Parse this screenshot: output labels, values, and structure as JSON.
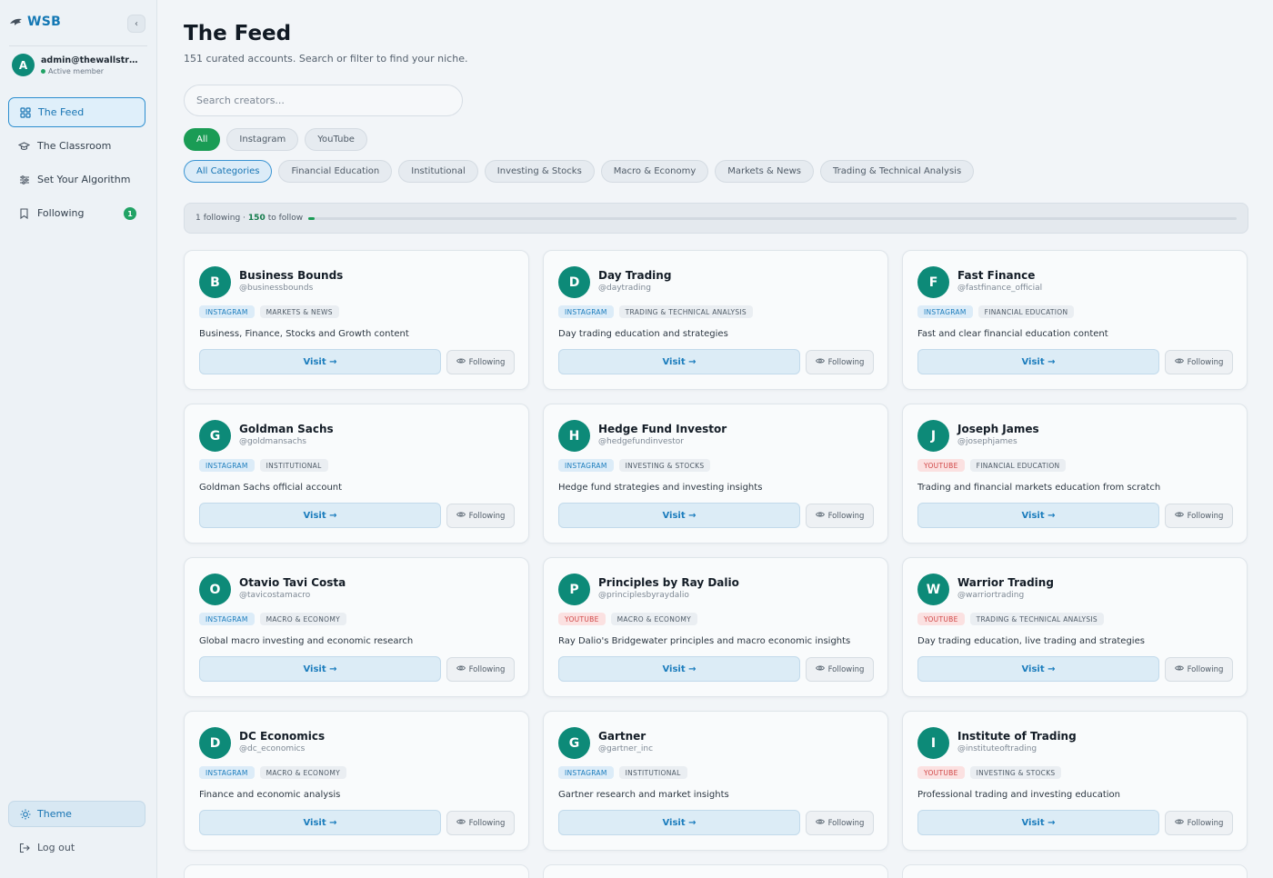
{
  "brand": {
    "name": "WSB",
    "icon": "shark-icon"
  },
  "sidebar": {
    "collapse_label": "‹",
    "user": {
      "initial": "A",
      "email": "admin@thewallstreetb...",
      "status": "Active member"
    },
    "items": [
      {
        "label": "The Feed",
        "icon": "grid-icon",
        "active": true
      },
      {
        "label": "The Classroom",
        "icon": "graduation-cap-icon"
      },
      {
        "label": "Set Your Algorithm",
        "icon": "sliders-icon"
      },
      {
        "label": "Following",
        "icon": "bookmark-icon",
        "badge": "1"
      }
    ],
    "theme_label": "Theme",
    "logout_label": "Log out"
  },
  "main": {
    "title": "The Feed",
    "subtitle": "151 curated accounts. Search or filter to find your niche.",
    "search_placeholder": "Search creators...",
    "platform_filters": [
      "All",
      "Instagram",
      "YouTube"
    ],
    "category_filters": [
      "All Categories",
      "Financial Education",
      "Institutional",
      "Investing & Stocks",
      "Macro & Economy",
      "Markets & News",
      "Trading & Technical Analysis"
    ],
    "progress": {
      "following": "1",
      "following_label": "following ·",
      "to_follow": "150",
      "to_follow_label": "to follow",
      "fraction": 0.0066
    }
  },
  "cards": [
    {
      "initial": "B",
      "name": "Business Bounds",
      "handle": "@businessbounds",
      "platform": "INSTAGRAM",
      "category": "MARKETS & NEWS",
      "desc": "Business, Finance, Stocks and Growth content",
      "visit": "Visit →",
      "follow": "Following"
    },
    {
      "initial": "D",
      "name": "Day Trading",
      "handle": "@daytrading",
      "platform": "INSTAGRAM",
      "category": "TRADING & TECHNICAL ANALYSIS",
      "desc": "Day trading education and strategies",
      "visit": "Visit →",
      "follow": "Following"
    },
    {
      "initial": "F",
      "name": "Fast Finance",
      "handle": "@fastfinance_official",
      "platform": "INSTAGRAM",
      "category": "FINANCIAL EDUCATION",
      "desc": "Fast and clear financial education content",
      "visit": "Visit →",
      "follow": "Following"
    },
    {
      "initial": "G",
      "name": "Goldman Sachs",
      "handle": "@goldmansachs",
      "platform": "INSTAGRAM",
      "category": "INSTITUTIONAL",
      "desc": "Goldman Sachs official account",
      "visit": "Visit →",
      "follow": "Following"
    },
    {
      "initial": "H",
      "name": "Hedge Fund Investor",
      "handle": "@hedgefundinvestor",
      "platform": "INSTAGRAM",
      "category": "INVESTING & STOCKS",
      "desc": "Hedge fund strategies and investing insights",
      "visit": "Visit →",
      "follow": "Following"
    },
    {
      "initial": "J",
      "name": "Joseph James",
      "handle": "@josephjames",
      "platform": "YOUTUBE",
      "category": "FINANCIAL EDUCATION",
      "desc": "Trading and financial markets education from scratch",
      "visit": "Visit →",
      "follow": "Following"
    },
    {
      "initial": "O",
      "name": "Otavio Tavi Costa",
      "handle": "@tavicostamacro",
      "platform": "INSTAGRAM",
      "category": "MACRO & ECONOMY",
      "desc": "Global macro investing and economic research",
      "visit": "Visit →",
      "follow": "Following"
    },
    {
      "initial": "P",
      "name": "Principles by Ray Dalio",
      "handle": "@principlesbyraydalio",
      "platform": "YOUTUBE",
      "category": "MACRO & ECONOMY",
      "desc": "Ray Dalio's Bridgewater principles and macro economic insights",
      "visit": "Visit →",
      "follow": "Following"
    },
    {
      "initial": "W",
      "name": "Warrior Trading",
      "handle": "@warriortrading",
      "platform": "YOUTUBE",
      "category": "TRADING & TECHNICAL ANALYSIS",
      "desc": "Day trading education, live trading and strategies",
      "visit": "Visit →",
      "follow": "Following"
    },
    {
      "initial": "D",
      "name": "DC Economics",
      "handle": "@dc_economics",
      "platform": "INSTAGRAM",
      "category": "MACRO & ECONOMY",
      "desc": "Finance and economic analysis",
      "visit": "Visit →",
      "follow": "Following"
    },
    {
      "initial": "G",
      "name": "Gartner",
      "handle": "@gartner_inc",
      "platform": "INSTAGRAM",
      "category": "INSTITUTIONAL",
      "desc": "Gartner research and market insights",
      "visit": "Visit →",
      "follow": "Following"
    },
    {
      "initial": "I",
      "name": "Institute of Trading",
      "handle": "@instituteoftrading",
      "platform": "YOUTUBE",
      "category": "INVESTING & STOCKS",
      "desc": "Professional trading and investing education",
      "visit": "Visit →",
      "follow": "Following"
    }
  ],
  "colors": {
    "accent_blue": "#1c7dbd",
    "accent_green": "#1a9c55",
    "avatar_teal": "#0d8a78",
    "youtube_red": "#d04545"
  }
}
